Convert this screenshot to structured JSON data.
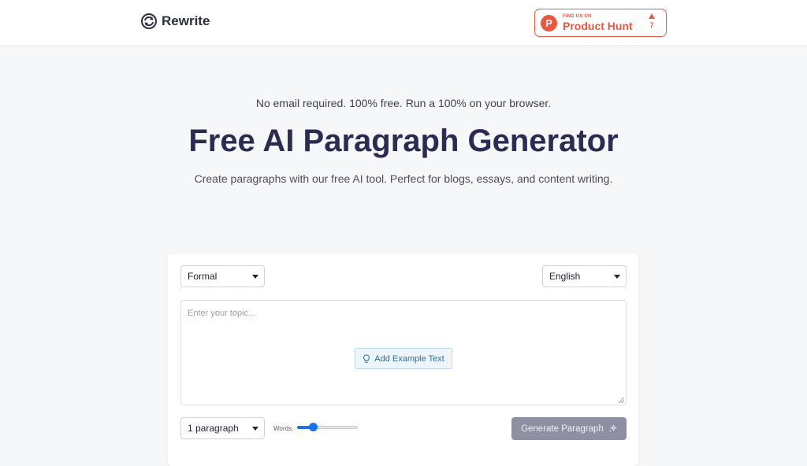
{
  "header": {
    "logo_text": "Rewrite",
    "logo_icon": "rewrite-logo-icon",
    "product_hunt": {
      "small_label": "FIND US ON",
      "big_label": "Product Hunt",
      "letter": "P",
      "votes": "7",
      "color": "#e9573f"
    }
  },
  "hero": {
    "subtitle": "No email required. 100% free. Run a 100% on your browser.",
    "title": "Free AI Paragraph Generator",
    "description": "Create paragraphs with our free AI tool. Perfect for blogs, essays, and content writing."
  },
  "form": {
    "tone_select": {
      "value": "Formal"
    },
    "language_select": {
      "value": "English"
    },
    "topic_input": {
      "placeholder": "Enter your topic...",
      "value": ""
    },
    "example_button": {
      "label": "Add Example Text",
      "icon": "lightbulb-icon"
    },
    "paragraph_count_select": {
      "value": "1 paragraph"
    },
    "words_label": "Words:",
    "words_slider": {
      "fraction": 0.26
    },
    "generate_button": {
      "label": "Generate Paragraph",
      "icon": "sparkle-icon"
    }
  },
  "colors": {
    "accent": "#1a73e8",
    "title": "#2c2c52",
    "generate_button_bg": "#8e8fa3",
    "example_button_bg": "#eef6fb"
  }
}
